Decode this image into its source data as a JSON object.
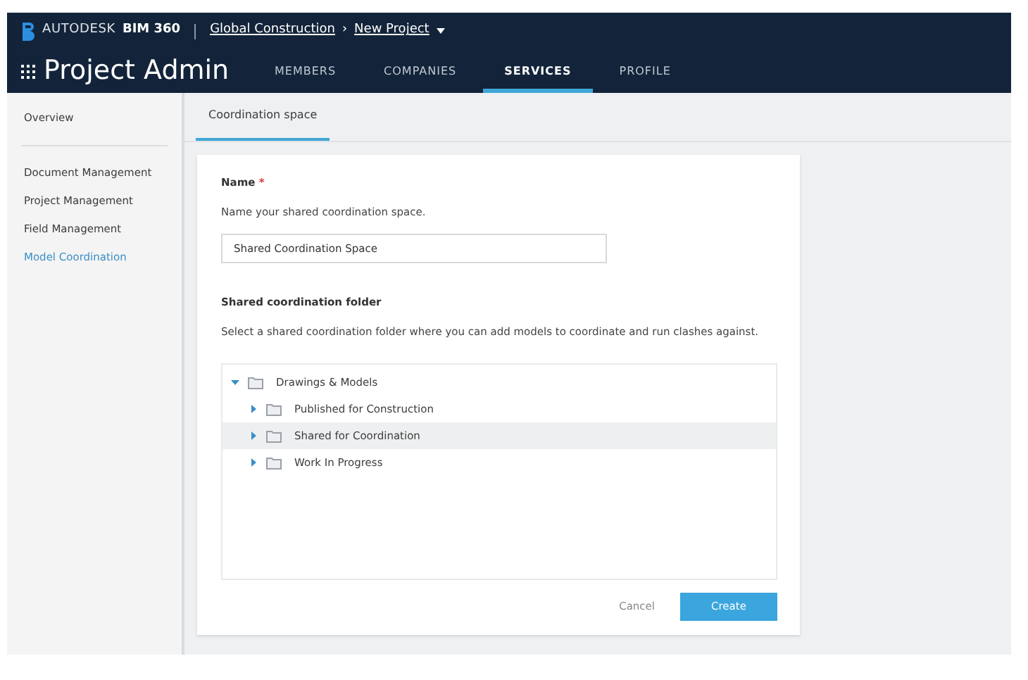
{
  "header": {
    "brand": [
      "AUTODESK",
      "BIM 360"
    ],
    "breadcrumb": [
      "Global Construction",
      "›",
      "New Project"
    ],
    "title": "Project Admin",
    "tabs": [
      {
        "label": "MEMBERS",
        "selected": false
      },
      {
        "label": "COMPANIES",
        "selected": false
      },
      {
        "label": "SERVICES",
        "selected": true
      },
      {
        "label": "PROFILE",
        "selected": false
      }
    ]
  },
  "sidebar": {
    "sections": [
      [
        {
          "label": "Overview",
          "selected": false
        }
      ],
      [
        {
          "label": "Document Management",
          "selected": false
        },
        {
          "label": "Project Management",
          "selected": false
        },
        {
          "label": "Field Management",
          "selected": false
        },
        {
          "label": "Model Coordination",
          "selected": true
        }
      ]
    ]
  },
  "content_tabs": [
    {
      "label": "Coordination space",
      "selected": true
    }
  ],
  "form": {
    "name_label": "Name",
    "required_mark": "*",
    "name_help": "Name your shared coordination space.",
    "name_value": "Shared Coordination Space",
    "folder_label": "Shared coordination folder",
    "folder_help": "Select a shared coordination folder where you can add models to coordinate and run clashes against.",
    "tree": [
      {
        "label": "Drawings & Models",
        "expanded": true,
        "selected": false,
        "children": [
          {
            "label": "Published for Construction",
            "expanded": false,
            "selected": false
          },
          {
            "label": "Shared for Coordination",
            "expanded": false,
            "selected": true
          },
          {
            "label": "Work In Progress",
            "expanded": false,
            "selected": false
          }
        ]
      }
    ],
    "buttons": [
      {
        "label": "Cancel",
        "kind": "secondary"
      },
      {
        "label": "Create",
        "kind": "primary"
      }
    ]
  }
}
